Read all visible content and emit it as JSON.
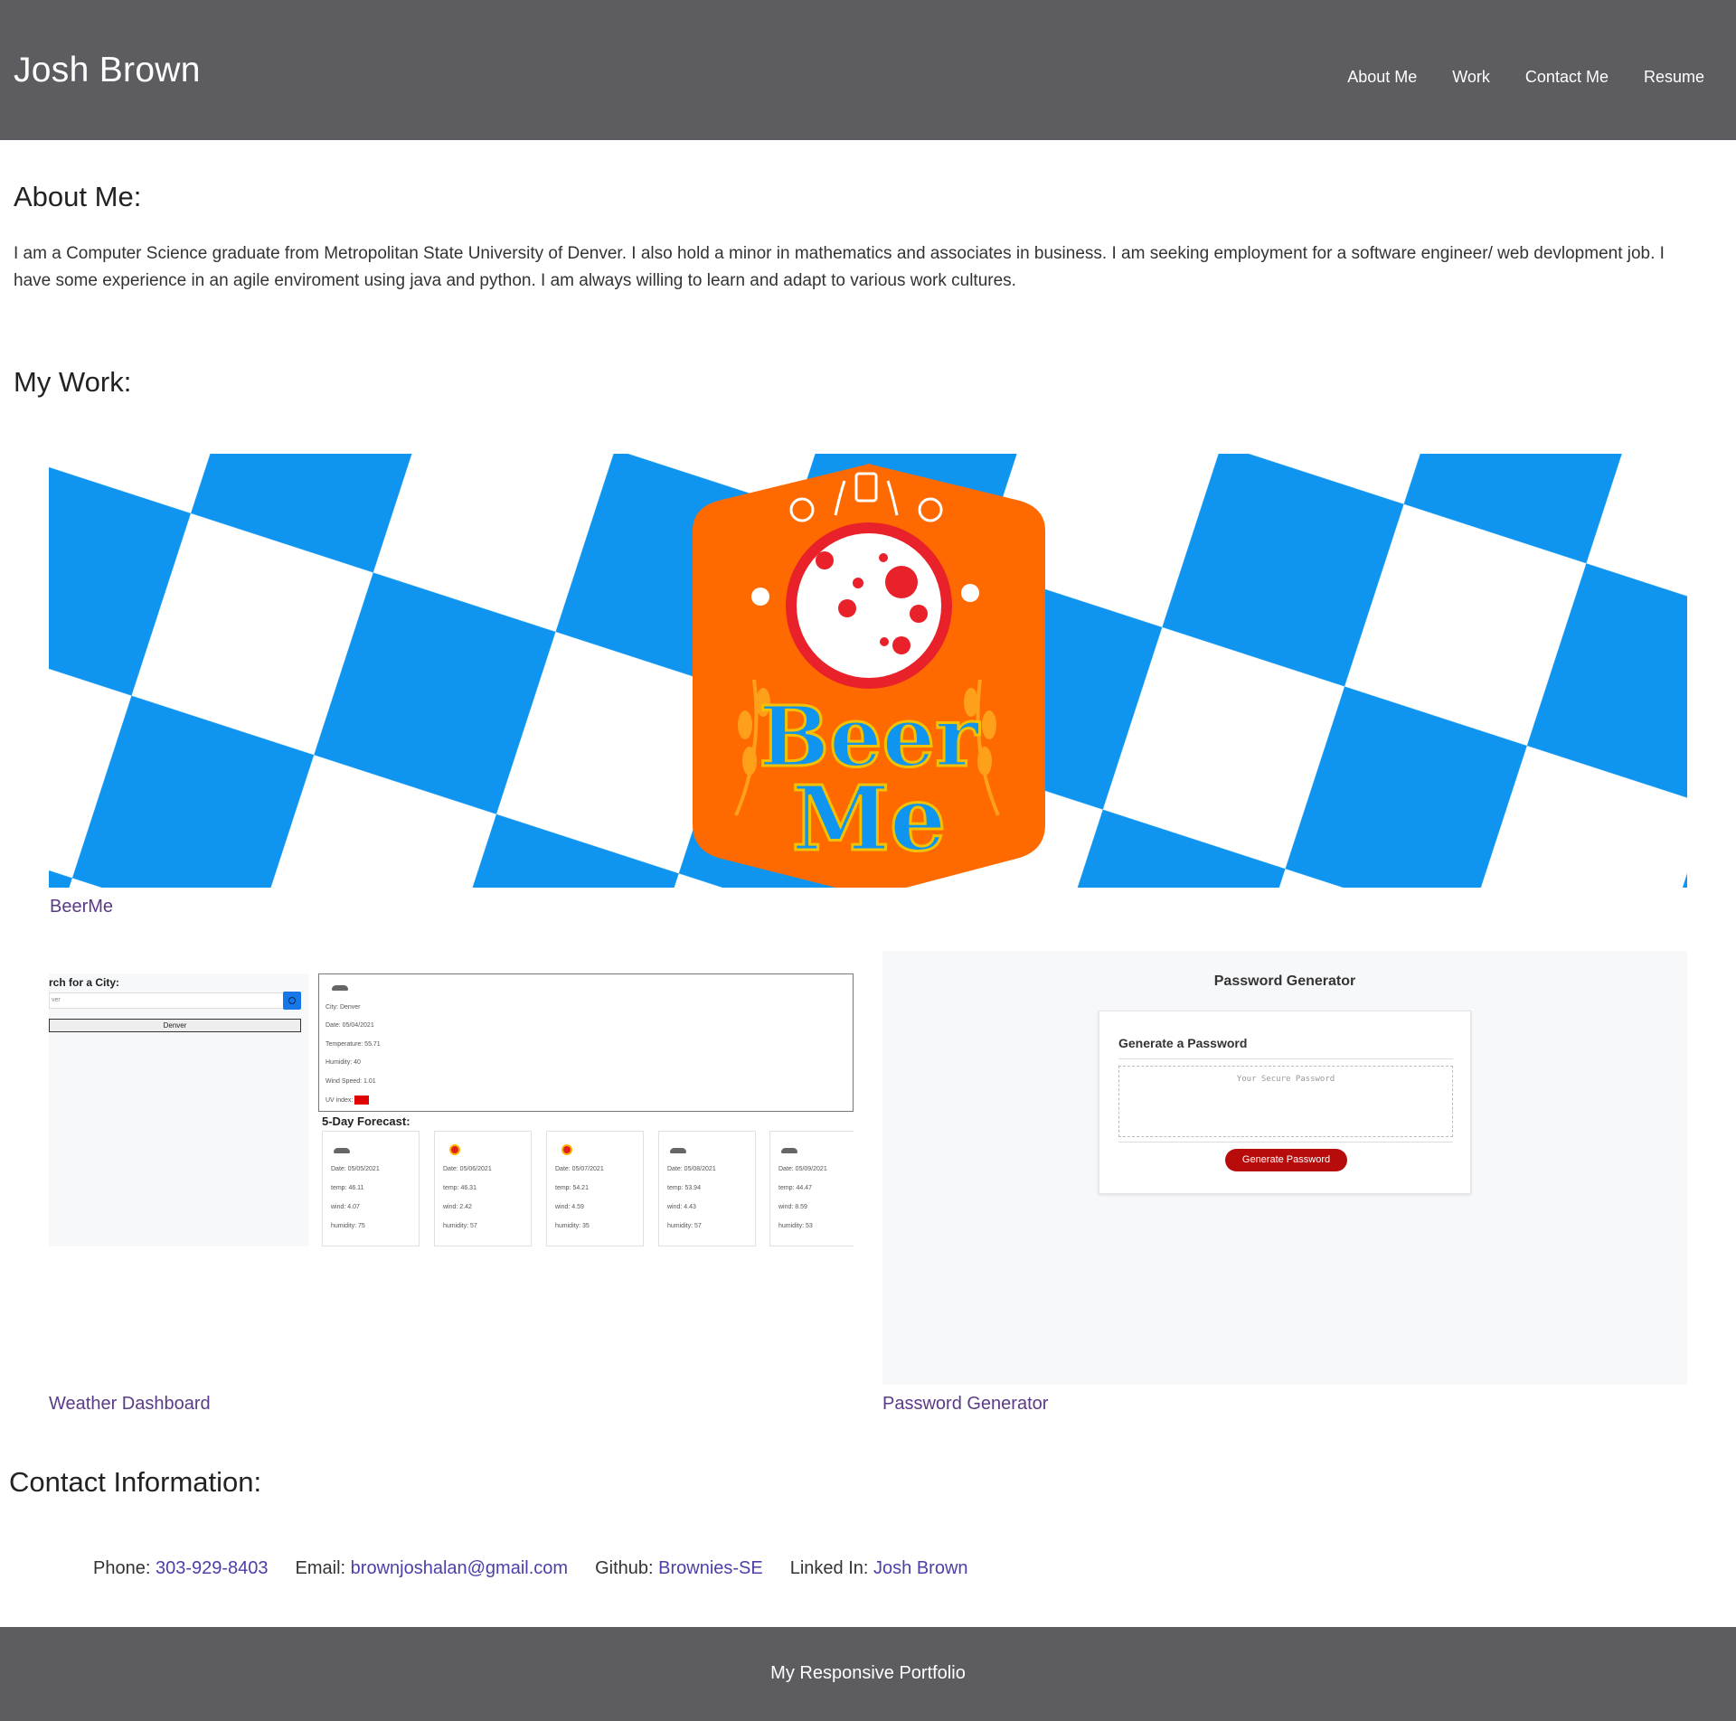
{
  "header": {
    "brand": "Josh Brown",
    "nav": [
      "About Me",
      "Work",
      "Contact Me",
      "Resume"
    ]
  },
  "about": {
    "title": "About Me:",
    "text": "I am a Computer Science graduate from Metropolitan State University of Denver. I also hold a minor in mathematics and associates in business. I am seeking employment for a software engineer/ web devlopment job. I have some experience in an agile enviroment using java and python. I am always willing to learn and adapt to various work cultures."
  },
  "work": {
    "title": "My Work:",
    "projects": [
      {
        "caption": "BeerMe",
        "logo_text": [
          "Beer",
          "Me"
        ]
      },
      {
        "caption": "Weather Dashboard",
        "search_title": "rch for a City:",
        "search_value": "ver",
        "city_button": "Denver",
        "current": [
          "City: Denver",
          "Date: 05/04/2021",
          "Temperature: 55.71",
          "Humidity: 40",
          "Wind Speed: 1.01",
          "UV index:"
        ],
        "forecast_title": "5-Day Forecast:",
        "forecast": [
          {
            "date": "Date: 05/05/2021",
            "temp": "temp: 46.11",
            "wind": "wind: 4.07",
            "humidity": "humidity: 75",
            "icon": "cloud-icon"
          },
          {
            "date": "Date: 05/06/2021",
            "temp": "temp: 46.31",
            "wind": "wind: 2.42",
            "humidity": "humidity: 57",
            "icon": "sun-icon"
          },
          {
            "date": "Date: 05/07/2021",
            "temp": "temp: 54.21",
            "wind": "wind: 4.59",
            "humidity": "humidity: 35",
            "icon": "sun-icon"
          },
          {
            "date": "Date: 05/08/2021",
            "temp": "temp: 53.94",
            "wind": "wind: 4.43",
            "humidity": "humidity: 57",
            "icon": "cloud-icon"
          },
          {
            "date": "Date: 05/09/2021",
            "temp": "temp: 44.47",
            "wind": "wind: 8.59",
            "humidity": "humidity: 53",
            "icon": "cloud-icon"
          }
        ]
      },
      {
        "caption": "Password Generator",
        "app_title": "Password Generator",
        "card_title": "Generate a Password",
        "placeholder": "Your Secure Password",
        "button": "Generate Password"
      }
    ]
  },
  "contact": {
    "title": "Contact Information:",
    "items": [
      {
        "label": "Phone:",
        "value": "303-929-8403"
      },
      {
        "label": "Email:",
        "value": "brownjoshalan@gmail.com"
      },
      {
        "label": "Github:",
        "value": "Brownies-SE"
      },
      {
        "label": "Linked In:",
        "value": "Josh Brown"
      }
    ]
  },
  "footer": {
    "text": "My Responsive Portfolio"
  },
  "colors": {
    "header_bg": "#5c5c61",
    "link": "#5b3a86",
    "bavarian_blue": "#0f95f0",
    "beer_orange": "#ff6a00",
    "generate_red": "#b80b0b"
  }
}
